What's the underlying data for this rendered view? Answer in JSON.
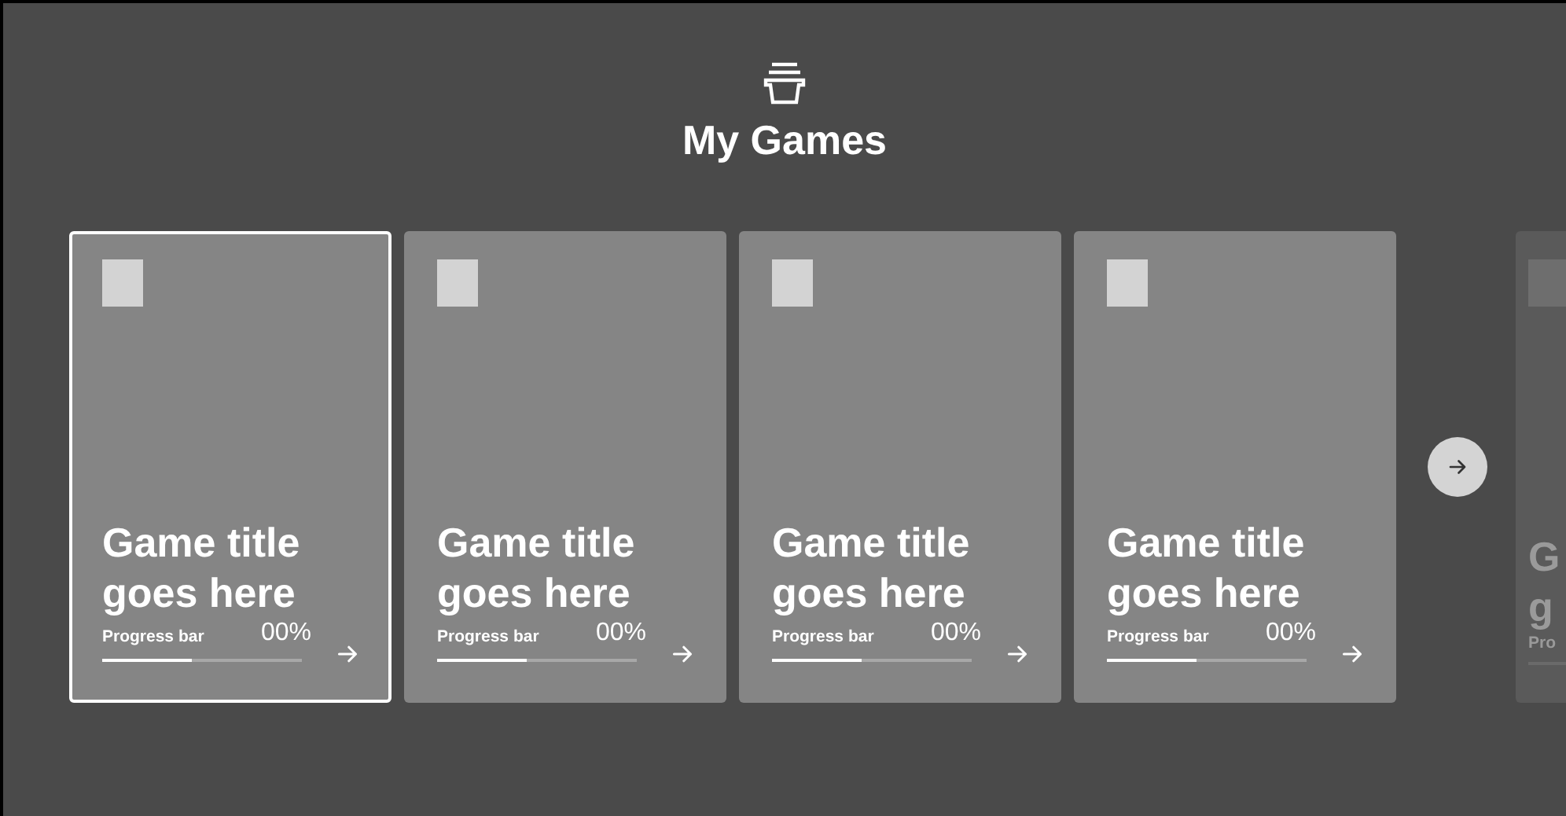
{
  "header": {
    "title": "My Games"
  },
  "games": [
    {
      "title_lines": [
        "Game title",
        "goes here"
      ],
      "progress_label": "Progress bar",
      "percent": "00%",
      "level": 0.45,
      "selected": true,
      "dimmed": false
    },
    {
      "title_lines": [
        "Game title",
        "goes here"
      ],
      "progress_label": "Progress bar",
      "percent": "00%",
      "level": 0.45,
      "selected": false,
      "dimmed": false
    },
    {
      "title_lines": [
        "Game title",
        "goes here"
      ],
      "progress_label": "Progress bar",
      "percent": "00%",
      "level": 0.45,
      "selected": false,
      "dimmed": false
    },
    {
      "title_lines": [
        "Game title",
        "goes here"
      ],
      "progress_label": "Progress bar",
      "percent": "00%",
      "level": 0.45,
      "selected": false,
      "dimmed": false
    },
    {
      "title_lines": [
        "G",
        "g"
      ],
      "progress_label": "Pro",
      "selected": false,
      "dimmed": true
    }
  ]
}
